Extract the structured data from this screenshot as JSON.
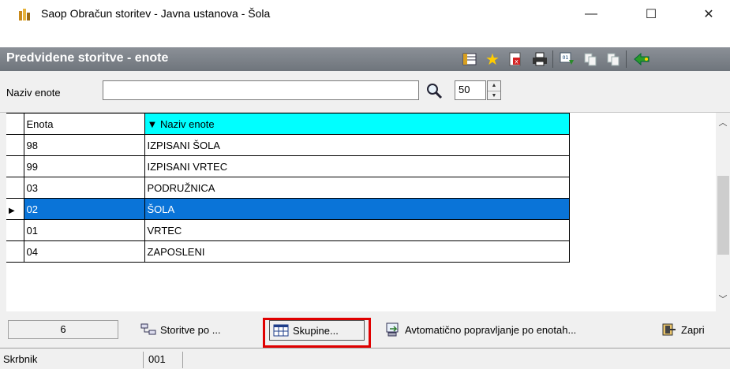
{
  "window": {
    "title": "Saop Obračun storitev - Javna ustanova - Šola",
    "minimize_glyph": "—",
    "maximize_glyph": "☐",
    "close_glyph": "✕"
  },
  "header": {
    "title": "Predvidene storitve - enote",
    "toolbar_icons": [
      "columns-icon",
      "star-icon",
      "delete-icon",
      "print-icon",
      "export-icon",
      "copy-icon",
      "paste-icon",
      "exit-icon"
    ]
  },
  "filter": {
    "label": "Naziv enote",
    "value": "",
    "limit": "50"
  },
  "grid": {
    "columns": [
      "Enota",
      "Naziv enote"
    ],
    "sort_indicator": "▼",
    "rows": [
      {
        "enota": "98",
        "naziv": "IZPISANI ŠOLA"
      },
      {
        "enota": "99",
        "naziv": "IZPISANI VRTEC"
      },
      {
        "enota": "03",
        "naziv": "PODRUŽNICA"
      },
      {
        "enota": "02",
        "naziv": "ŠOLA"
      },
      {
        "enota": "01",
        "naziv": "VRTEC"
      },
      {
        "enota": "04",
        "naziv": "ZAPOSLENI"
      }
    ],
    "selected_index": 3
  },
  "buttons": {
    "count": "6",
    "storitve": "Storitve po ...",
    "skupine": "Skupine...",
    "avtomaticno": "Avtomatično popravljanje po enotah...",
    "zapri": "Zapri"
  },
  "status": {
    "user_label": "Skrbnik",
    "code": "001"
  },
  "colors": {
    "selection": "#0a74d8",
    "sorted_header": "#00ffff",
    "highlight": "#e00000"
  }
}
